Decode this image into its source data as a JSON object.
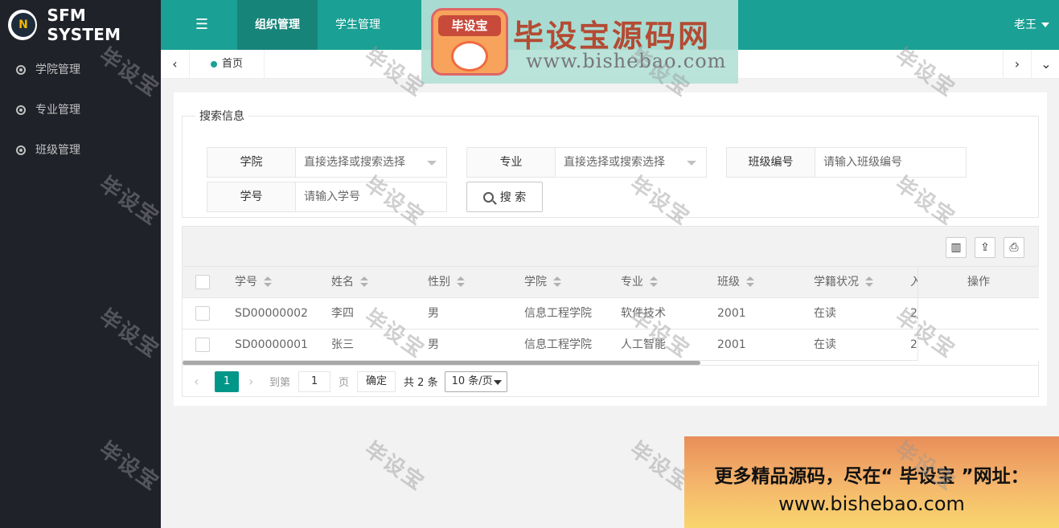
{
  "app": {
    "title": "SFM SYSTEM",
    "logo_text": "N"
  },
  "header": {
    "tabs": [
      {
        "label": "组织管理"
      },
      {
        "label": "学生管理"
      }
    ],
    "user": "老王"
  },
  "sidebar": {
    "items": [
      {
        "label": "学院管理"
      },
      {
        "label": "专业管理"
      },
      {
        "label": "班级管理"
      }
    ]
  },
  "tabbar": {
    "home_label": "首页"
  },
  "search": {
    "legend": "搜索信息",
    "fields": [
      {
        "label": "学院",
        "placeholder": "直接选择或搜索选择"
      },
      {
        "label": "专业",
        "placeholder": "直接选择或搜索选择"
      },
      {
        "label": "班级编号",
        "placeholder": "请输入班级编号"
      },
      {
        "label": "学号",
        "placeholder": "请输入学号"
      }
    ],
    "button_label": "搜 索"
  },
  "table": {
    "columns": [
      "学号",
      "姓名",
      "性别",
      "学院",
      "专业",
      "班级",
      "学籍状况",
      "入",
      "操作"
    ],
    "rows": [
      {
        "student_id": "SD00000002",
        "name": "李四",
        "gender": "男",
        "college": "信息工程学院",
        "major": "软件技术",
        "class": "2001",
        "status": "在读",
        "extra": "2"
      },
      {
        "student_id": "SD00000001",
        "name": "张三",
        "gender": "男",
        "college": "信息工程学院",
        "major": "人工智能",
        "class": "2001",
        "status": "在读",
        "extra": "2"
      }
    ]
  },
  "pager": {
    "current_page": "1",
    "goto_label": "到第",
    "page_input": "1",
    "page_unit": "页",
    "ok_label": "确定",
    "total_label": "共 2 条",
    "page_size": "10 条/页"
  },
  "watermark_text": "毕设宝",
  "banner": {
    "logo_text": "毕设宝",
    "title": "毕设宝源码网",
    "url": "www.bishebao.com"
  },
  "promo": {
    "line1": "更多精品源码，尽在“ 毕设宝 ”网址：",
    "line2": "www.bishebao.com"
  }
}
